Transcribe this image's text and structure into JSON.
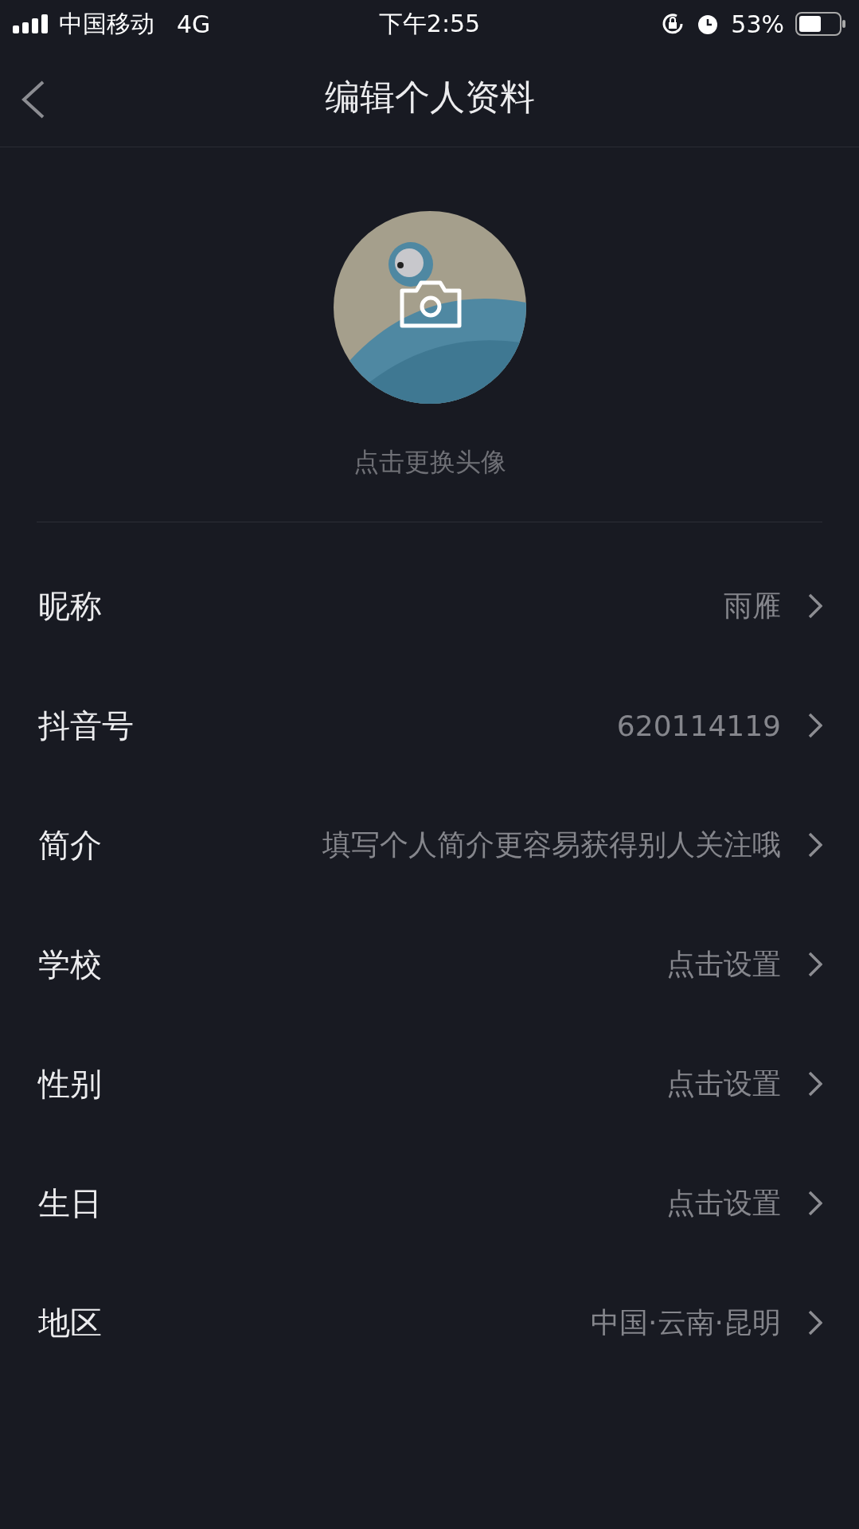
{
  "status_bar": {
    "carrier": "中国移动",
    "network": "4G",
    "time": "下午2:55",
    "battery": "53%"
  },
  "nav": {
    "title": "编辑个人资料"
  },
  "avatar": {
    "caption": "点击更换头像"
  },
  "fields": [
    {
      "label": "昵称",
      "value": "雨雁"
    },
    {
      "label": "抖音号",
      "value": "620114119"
    },
    {
      "label": "简介",
      "value": "填写个人简介更容易获得别人关注哦"
    },
    {
      "label": "学校",
      "value": "点击设置"
    },
    {
      "label": "性别",
      "value": "点击设置"
    },
    {
      "label": "生日",
      "value": "点击设置"
    },
    {
      "label": "地区",
      "value": "中国·云南·昆明"
    }
  ]
}
